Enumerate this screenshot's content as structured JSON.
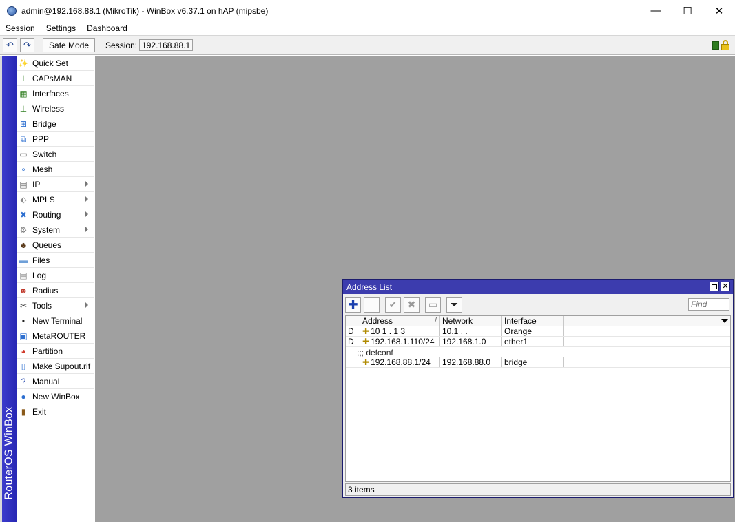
{
  "window": {
    "title": "admin@192.168.88.1 (MikroTik) - WinBox v6.37.1 on hAP (mipsbe)",
    "controls": {
      "minimize": "—",
      "maximize": "☐",
      "close": "✕"
    }
  },
  "menubar": {
    "items": [
      "Session",
      "Settings",
      "Dashboard"
    ]
  },
  "toolbar": {
    "undo_icon": "↶",
    "redo_icon": "↷",
    "safe_mode_label": "Safe Mode",
    "session_label": "Session:",
    "session_value": "192.168.88.1",
    "status_colors": {
      "connection": "#2e7d1f",
      "lock": "#e8c21c"
    }
  },
  "vertical_brand": "RouterOS WinBox",
  "sidebar": {
    "items": [
      {
        "label": "Quick Set",
        "icon": "quick-set-icon",
        "glyph": "✨",
        "color": "#444",
        "submenu": false
      },
      {
        "label": "CAPsMAN",
        "icon": "capsman-icon",
        "glyph": "⊥",
        "color": "#2e7d1f",
        "submenu": false
      },
      {
        "label": "Interfaces",
        "icon": "interfaces-icon",
        "glyph": "▦",
        "color": "#2e7d1f",
        "submenu": false
      },
      {
        "label": "Wireless",
        "icon": "wireless-icon",
        "glyph": "⊥",
        "color": "#2e7d1f",
        "submenu": false
      },
      {
        "label": "Bridge",
        "icon": "bridge-icon",
        "glyph": "⊞",
        "color": "#2d6fd0",
        "submenu": false
      },
      {
        "label": "PPP",
        "icon": "ppp-icon",
        "glyph": "⧉",
        "color": "#2d6fd0",
        "submenu": false
      },
      {
        "label": "Switch",
        "icon": "switch-icon",
        "glyph": "▭",
        "color": "#666",
        "submenu": false
      },
      {
        "label": "Mesh",
        "icon": "mesh-icon",
        "glyph": "∘",
        "color": "#2d6fd0",
        "submenu": false
      },
      {
        "label": "IP",
        "icon": "ip-icon",
        "glyph": "▤",
        "color": "#666",
        "submenu": true
      },
      {
        "label": "MPLS",
        "icon": "mpls-icon",
        "glyph": "⬖",
        "color": "#888",
        "submenu": true
      },
      {
        "label": "Routing",
        "icon": "routing-icon",
        "glyph": "✖",
        "color": "#2d6fd0",
        "submenu": true
      },
      {
        "label": "System",
        "icon": "system-icon",
        "glyph": "⚙",
        "color": "#777",
        "submenu": true
      },
      {
        "label": "Queues",
        "icon": "queues-icon",
        "glyph": "♣",
        "color": "#5a3a1a",
        "submenu": false
      },
      {
        "label": "Files",
        "icon": "files-icon",
        "glyph": "▬",
        "color": "#6fa0d8",
        "submenu": false
      },
      {
        "label": "Log",
        "icon": "log-icon",
        "glyph": "▤",
        "color": "#888",
        "submenu": false
      },
      {
        "label": "Radius",
        "icon": "radius-icon",
        "glyph": "☻",
        "color": "#c0392b",
        "submenu": false
      },
      {
        "label": "Tools",
        "icon": "tools-icon",
        "glyph": "✂",
        "color": "#444",
        "submenu": true
      },
      {
        "label": "New Terminal",
        "icon": "terminal-icon",
        "glyph": "▪",
        "color": "#222",
        "submenu": false
      },
      {
        "label": "MetaROUTER",
        "icon": "metarouter-icon",
        "glyph": "▣",
        "color": "#2d6fd0",
        "submenu": false
      },
      {
        "label": "Partition",
        "icon": "partition-icon",
        "glyph": "◕",
        "color": "#d03a2a",
        "submenu": false
      },
      {
        "label": "Make Supout.rif",
        "icon": "supout-icon",
        "glyph": "▯",
        "color": "#2d6fd0",
        "submenu": false
      },
      {
        "label": "Manual",
        "icon": "manual-icon",
        "glyph": "?",
        "color": "#2d4fb0",
        "submenu": false
      },
      {
        "label": "New WinBox",
        "icon": "winbox-icon",
        "glyph": "●",
        "color": "#2d6fd0",
        "submenu": false
      },
      {
        "label": "Exit",
        "icon": "exit-icon",
        "glyph": "▮",
        "color": "#8a5a1a",
        "submenu": false
      }
    ]
  },
  "address_list": {
    "title": "Address List",
    "find_placeholder": "Find",
    "toolbar_buttons": [
      {
        "name": "add-button",
        "glyph": "✚"
      },
      {
        "name": "remove-button",
        "glyph": "—"
      },
      {
        "name": "enable-button",
        "glyph": "✔"
      },
      {
        "name": "disable-button",
        "glyph": "✖"
      },
      {
        "name": "comment-button",
        "glyph": "▭"
      },
      {
        "name": "filter-button",
        "glyph": "⏷"
      }
    ],
    "columns": {
      "flag": "",
      "address": "Address",
      "sort_mark": "/",
      "network": "Network",
      "interface": "Interface"
    },
    "rows": [
      {
        "flag": "D",
        "address": "10 1 . 1 3",
        "network": "10.1 . .",
        "interface": "Orange",
        "comment": ""
      },
      {
        "flag": "D",
        "address": "192.168.1.110/24",
        "network": "192.168.1.0",
        "interface": "ether1",
        "comment": ""
      },
      {
        "flag": "",
        "address": "192.168.88.1/24",
        "network": "192.168.88.0",
        "interface": "bridge",
        "comment": ";;; defconf"
      }
    ],
    "status": "3 items"
  }
}
